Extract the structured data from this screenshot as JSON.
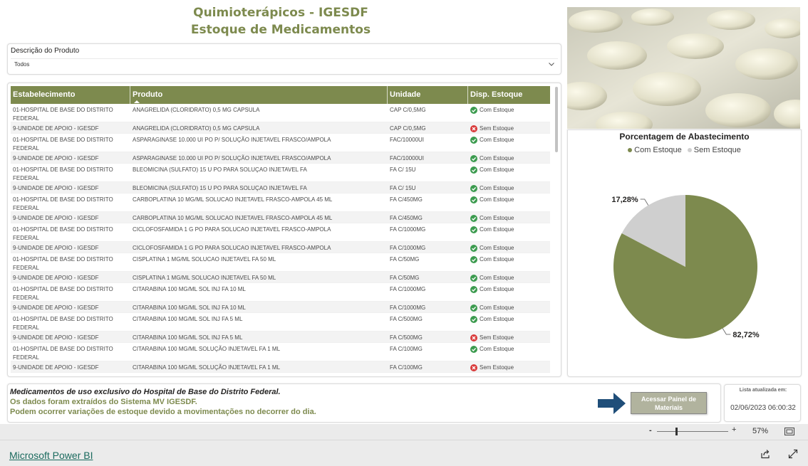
{
  "header": {
    "title_line1": "Quimioterápicos - IGESDF",
    "title_line2": "Estoque de Medicamentos"
  },
  "filter": {
    "label": "Descrição do Produto",
    "value": "Todos"
  },
  "table": {
    "columns": [
      "Estabelecimento",
      "Produto",
      "Unidade",
      "Disp. Estoque"
    ],
    "rows": [
      {
        "estabelecimento": "01-HOSPITAL DE BASE DO DISTRITO FEDERAL",
        "produto": "ANAGRELIDA (CLORIDRATO) 0,5 MG CAPSULA",
        "unidade": "CAP C/0,5MG",
        "estoque": "Com Estoque",
        "ok": true
      },
      {
        "estabelecimento": "9-UNIDADE DE APOIO - IGESDF",
        "produto": "ANAGRELIDA (CLORIDRATO) 0,5 MG CAPSULA",
        "unidade": "CAP C/0,5MG",
        "estoque": "Sem Estoque",
        "ok": false
      },
      {
        "estabelecimento": "01-HOSPITAL DE BASE DO DISTRITO FEDERAL",
        "produto": "ASPARAGINASE 10.000 UI PO P/ SOLUÇÃO INJETAVEL FRASCO/AMPOLA",
        "unidade": "FAC/10000UI",
        "estoque": "Com Estoque",
        "ok": true
      },
      {
        "estabelecimento": "9-UNIDADE DE APOIO - IGESDF",
        "produto": "ASPARAGINASE 10.000 UI PO P/ SOLUÇÃO INJETAVEL FRASCO/AMPOLA",
        "unidade": "FAC/10000UI",
        "estoque": "Com Estoque",
        "ok": true
      },
      {
        "estabelecimento": "01-HOSPITAL DE BASE DO DISTRITO FEDERAL",
        "produto": "BLEOMICINA (SULFATO) 15 U PO PARA SOLUÇAO INJETAVEL FA",
        "unidade": "FA C/ 15U",
        "estoque": "Com Estoque",
        "ok": true
      },
      {
        "estabelecimento": "9-UNIDADE DE APOIO - IGESDF",
        "produto": "BLEOMICINA (SULFATO) 15 U PO PARA SOLUÇAO INJETAVEL FA",
        "unidade": "FA C/ 15U",
        "estoque": "Com Estoque",
        "ok": true
      },
      {
        "estabelecimento": "01-HOSPITAL DE BASE DO DISTRITO FEDERAL",
        "produto": "CARBOPLATINA 10 MG/ML SOLUCAO INJETAVEL FRASCO-AMPOLA 45 ML",
        "unidade": "FA C/450MG",
        "estoque": "Com Estoque",
        "ok": true
      },
      {
        "estabelecimento": "9-UNIDADE DE APOIO - IGESDF",
        "produto": "CARBOPLATINA 10 MG/ML SOLUCAO INJETAVEL FRASCO-AMPOLA 45 ML",
        "unidade": "FA C/450MG",
        "estoque": "Com Estoque",
        "ok": true
      },
      {
        "estabelecimento": "01-HOSPITAL DE BASE DO DISTRITO FEDERAL",
        "produto": "CICLOFOSFAMIDA 1 G PO PARA SOLUCAO INJETAVEL FRASCO-AMPOLA",
        "unidade": "FA C/1000MG",
        "estoque": "Com Estoque",
        "ok": true
      },
      {
        "estabelecimento": "9-UNIDADE DE APOIO - IGESDF",
        "produto": "CICLOFOSFAMIDA 1 G PO PARA SOLUCAO INJETAVEL FRASCO-AMPOLA",
        "unidade": "FA C/1000MG",
        "estoque": "Com Estoque",
        "ok": true
      },
      {
        "estabelecimento": "01-HOSPITAL DE BASE DO DISTRITO FEDERAL",
        "produto": "CISPLATINA 1 MG/ML SOLUCAO INJETAVEL FA 50 ML",
        "unidade": "FA C/50MG",
        "estoque": "Com Estoque",
        "ok": true
      },
      {
        "estabelecimento": "9-UNIDADE DE APOIO - IGESDF",
        "produto": "CISPLATINA 1 MG/ML SOLUCAO INJETAVEL FA 50 ML",
        "unidade": "FA C/50MG",
        "estoque": "Com Estoque",
        "ok": true
      },
      {
        "estabelecimento": "01-HOSPITAL DE BASE DO DISTRITO FEDERAL",
        "produto": "CITARABINA 100 MG/ML SOL INJ FA 10 ML",
        "unidade": "FA C/1000MG",
        "estoque": "Com Estoque",
        "ok": true
      },
      {
        "estabelecimento": "9-UNIDADE DE APOIO - IGESDF",
        "produto": "CITARABINA 100 MG/ML SOL INJ FA 10 ML",
        "unidade": "FA C/1000MG",
        "estoque": "Com Estoque",
        "ok": true
      },
      {
        "estabelecimento": "01-HOSPITAL DE BASE DO DISTRITO FEDERAL",
        "produto": "CITARABINA 100 MG/ML SOL INJ FA 5 ML",
        "unidade": "FA C/500MG",
        "estoque": "Com Estoque",
        "ok": true
      },
      {
        "estabelecimento": "9-UNIDADE DE APOIO - IGESDF",
        "produto": "CITARABINA 100 MG/ML SOL INJ FA 5 ML",
        "unidade": "FA C/500MG",
        "estoque": "Sem Estoque",
        "ok": false
      },
      {
        "estabelecimento": "01-HOSPITAL DE BASE DO DISTRITO FEDERAL",
        "produto": "CITARABINA 100 MG/ML SOLUÇÃO INJETAVEL FA 1 ML",
        "unidade": "FA C/100MG",
        "estoque": "Com Estoque",
        "ok": true
      },
      {
        "estabelecimento": "9-UNIDADE DE APOIO - IGESDF",
        "produto": "CITARABINA 100 MG/ML SOLUÇÃO INJETAVEL FA 1 ML",
        "unidade": "FA C/100MG",
        "estoque": "Sem Estoque",
        "ok": false
      }
    ]
  },
  "chart_data": {
    "type": "pie",
    "title": "Porcentagem de Abastecimento",
    "legend_position": "top",
    "series": [
      {
        "name": "Com Estoque",
        "value": 82.72,
        "label": "82,72%",
        "color": "#7d8a4e"
      },
      {
        "name": "Sem Estoque",
        "value": 17.28,
        "label": "17,28%",
        "color": "#cfcfcf"
      }
    ]
  },
  "footer": {
    "note1": "Medicamentos de uso exclusivo do Hospital de Base do Distrito Federal.",
    "note2": "Os dados foram extraídos do Sistema MV IGESDF.",
    "note3": "Podem ocorrer variações de estoque devido a movimentações no decorrer do dia.",
    "button_label": "Acessar Painel de Materiais",
    "updated_label": "Lista atualizada em:",
    "updated_value": "02/06/2023 06:00:32"
  },
  "zoom": {
    "minus": "-",
    "plus": "+",
    "value": "57%"
  },
  "bottom_bar": {
    "brand": "Microsoft Power BI"
  },
  "colors": {
    "accent": "#7d8a4e",
    "ok": "#3c9b4f",
    "error": "#d93a3a",
    "arrow": "#1f4e79"
  },
  "icons": [
    "chevron-down-icon",
    "check-circle-icon",
    "x-circle-icon",
    "arrow-right-icon",
    "fit-to-page-icon",
    "share-icon",
    "expand-icon"
  ]
}
